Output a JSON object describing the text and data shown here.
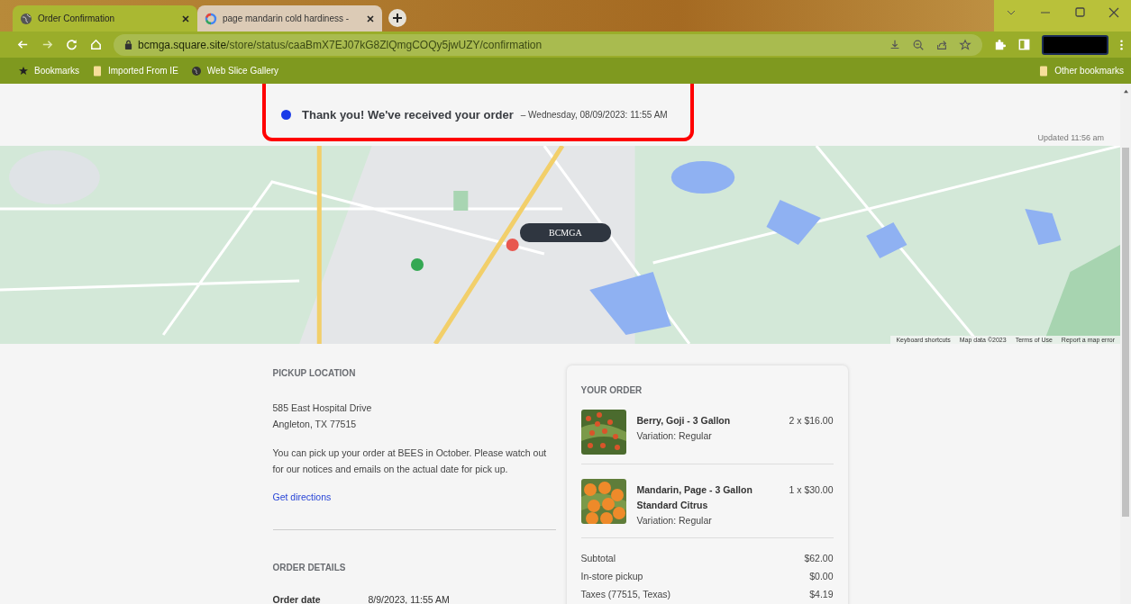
{
  "browser": {
    "tabs": [
      {
        "title": "Order Confirmation",
        "selected": true
      },
      {
        "title": "page mandarin cold hardiness -",
        "selected": false
      }
    ],
    "url_host": "bcmga.square.site",
    "url_path": "/store/status/caaBmX7EJ07kG8ZlQmgCOQy5jwUZY/confirmation",
    "bookmarks": [
      {
        "label": "Bookmarks"
      },
      {
        "label": "Imported From IE"
      },
      {
        "label": "Web Slice Gallery"
      }
    ],
    "other_bookmarks": "Other bookmarks"
  },
  "banner": {
    "title": "Thank you! We've received your order",
    "timestamp": "– Wednesday, 08/09/2023: 11:55 AM",
    "updated": "Updated 11:56 am",
    "highlighted": true
  },
  "map": {
    "marker": "BCMGA",
    "footer_links": [
      "Keyboard shortcuts",
      "Map data ©2023",
      "Terms of Use",
      "Report a map error"
    ]
  },
  "pickup": {
    "heading": "PICKUP LOCATION",
    "address_lines": [
      "585 East Hospital Drive",
      "Angleton, TX 77515"
    ],
    "note": "You can pick up your order at BEES in October. Please watch out for our notices and emails on the actual date for pick up.",
    "link": "Get directions"
  },
  "order_details": {
    "heading": "ORDER DETAILS",
    "rows": [
      {
        "label": "Order date",
        "value": "8/9/2023, 11:55 AM"
      }
    ]
  },
  "order": {
    "heading": "YOUR ORDER",
    "items": [
      {
        "name": "Berry, Goji - 3 Gallon",
        "variation": "Variation: Regular",
        "price": "2 x $16.00"
      },
      {
        "name": "Mandarin, Page - 3 Gallon Standard Citrus",
        "variation": "Variation: Regular",
        "price": "1 x $30.00"
      }
    ],
    "totals": [
      {
        "label": "Subtotal",
        "value": "$62.00"
      },
      {
        "label": "In-store pickup",
        "value": "$0.00"
      },
      {
        "label": "Taxes (77515, Texas)",
        "value": "$4.19"
      }
    ]
  }
}
